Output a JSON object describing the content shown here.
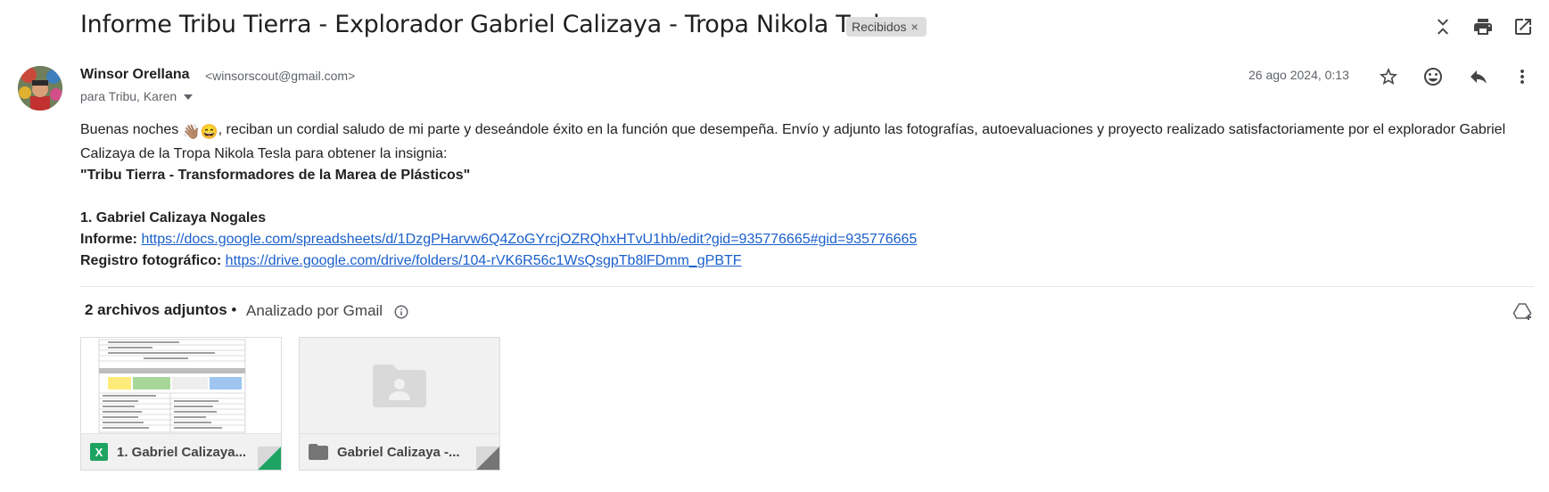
{
  "email": {
    "subject": "Informe Tribu Tierra - Explorador Gabriel Calizaya - Tropa Nikola Tesla",
    "label": "Recibidos",
    "label_remove": "×",
    "sender_name": "Winsor Orellana",
    "sender_email": "<winsorscout@gmail.com>",
    "recipients": "para Tribu, Karen",
    "date": "26 ago 2024, 0:13"
  },
  "body": {
    "greeting": "Buenas noches ",
    "emoji": "👋🏽😄",
    "line1": ", reciban un cordial saludo de mi parte y deseándole éxito en la función que desempeña. Envío y adjunto las fotografías, autoevaluaciones y proyecto realizado satisfactoriamente por el explorador Gabriel Calizaya de la Tropa Nikola Tesla para obtener la insignia:",
    "insignia": "\"Tribu Tierra - Transformadores de la Marea de Plásticos\"",
    "item_title": "1. Gabriel Calizaya Nogales",
    "informe_label": "Informe:",
    "informe_link": "https://docs.google.com/spreadsheets/d/1DzgPHarvw6Q4ZoGYrcjOZRQhxHTvU1hb/edit?gid=935776665#gid=935776665",
    "registro_label": "Registro fotográfico:",
    "registro_link": "https://drive.google.com/drive/folders/104-rVK6R56c1WsQsgpTb8lFDmm_gPBTF"
  },
  "attachments": {
    "count_label": "2 archivos adjuntos",
    "separator": " •",
    "analyzed": "Analizado por Gmail",
    "files": [
      {
        "name": "1. Gabriel Calizaya...",
        "type": "sheet",
        "accent": "#1ea362"
      },
      {
        "name": "Gabriel Calizaya -...",
        "type": "folder",
        "accent": "#757575"
      }
    ]
  },
  "icons": {
    "collapse": "collapse-icon",
    "print": "print-icon",
    "open_new": "open-in-new-icon",
    "star": "star-icon",
    "emoji_react": "emoji-icon",
    "reply": "reply-icon",
    "more": "more-vert-icon",
    "drive_add": "add-to-drive-icon"
  }
}
